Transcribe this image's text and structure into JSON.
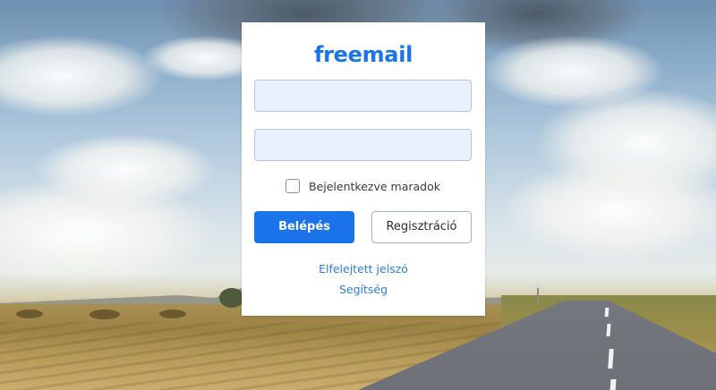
{
  "brand": {
    "logo_text": "freemail",
    "accent_color": "#1a73e8"
  },
  "form": {
    "username_value": "",
    "password_value": "",
    "remember_label": "Bejelentkezve maradok",
    "remember_checked": false
  },
  "buttons": {
    "login_label": "Belépés",
    "register_label": "Regisztráció"
  },
  "links": {
    "forgot_password": "Elfelejtett jelszó",
    "help": "Segítség"
  }
}
